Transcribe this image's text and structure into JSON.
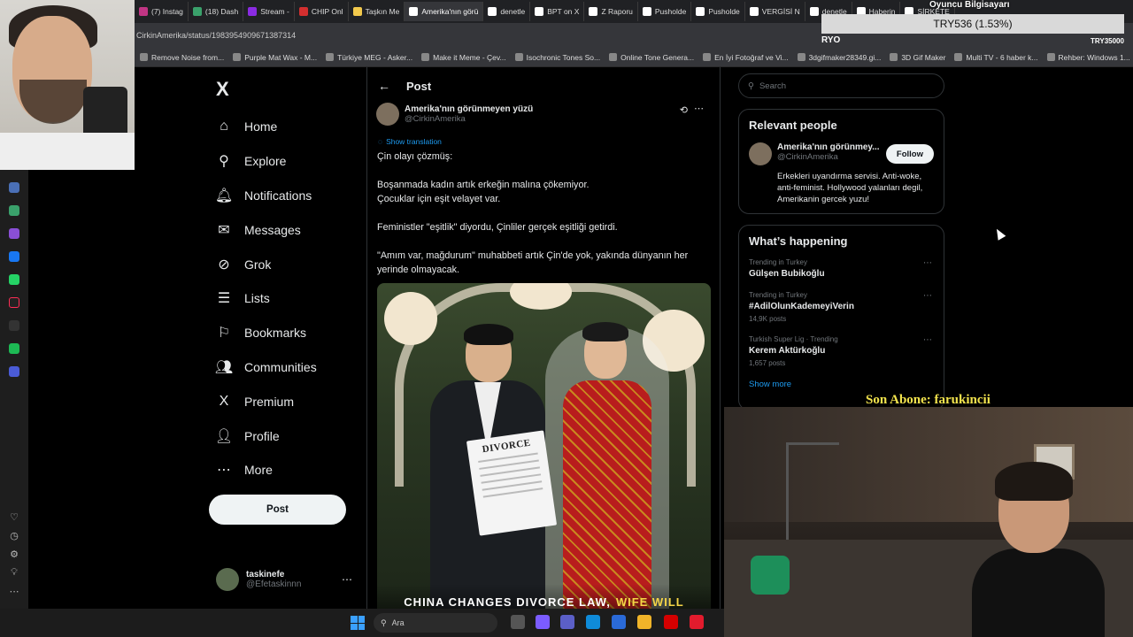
{
  "browser": {
    "tabs": [
      {
        "label": "(7) Instag",
        "color": "#c13584"
      },
      {
        "label": "(18) Dash",
        "color": "#3aa16b"
      },
      {
        "label": "Stream -",
        "color": "#8a2be2"
      },
      {
        "label": "CHIP Onl",
        "color": "#d32f2f"
      },
      {
        "label": "Taşkın Me",
        "color": "#f2c94c"
      },
      {
        "label": "Amerika'nın görü",
        "color": "#ffffff"
      },
      {
        "label": "denetle",
        "color": "#ffffff"
      },
      {
        "label": "BPT on X",
        "color": "#ffffff"
      },
      {
        "label": "Z Raporu",
        "color": "#ffffff"
      },
      {
        "label": "Pusholde",
        "color": "#ffffff"
      },
      {
        "label": "Pusholde",
        "color": "#ffffff"
      },
      {
        "label": "VERGİSİ N",
        "color": "#ffffff"
      },
      {
        "label": "denetle",
        "color": "#ffffff"
      },
      {
        "label": "Haberin",
        "color": "#ffffff"
      },
      {
        "label": "ŞİRKETE",
        "color": "#ffffff"
      }
    ],
    "active_tab": "Amerika'nın görü",
    "url": "CirkinAmerika/status/1983954909671387314",
    "bookmarks": [
      "Remove Noise from...",
      "Purple Mat Wax - M...",
      "Türkiye MEG - Asker...",
      "Make it Meme - Çev...",
      "Isochronic Tones So...",
      "Online Tone Genera...",
      "En İyi Fotoğraf ve Vi...",
      "3dgifmaker28349.gi...",
      "3D Gif Maker",
      "Multi TV - 6 haber k...",
      "Rehber: Windows 1..."
    ]
  },
  "sidebar": {
    "logo": "X",
    "items": [
      {
        "label": "Home",
        "icon": "home-icon",
        "glyph": "⌂"
      },
      {
        "label": "Explore",
        "icon": "search-icon",
        "glyph": "⚲"
      },
      {
        "label": "Notifications",
        "icon": "bell-icon",
        "glyph": "🔔︎"
      },
      {
        "label": "Messages",
        "icon": "envelope-icon",
        "glyph": "✉"
      },
      {
        "label": "Grok",
        "icon": "grok-icon",
        "glyph": "⊘"
      },
      {
        "label": "Lists",
        "icon": "list-icon",
        "glyph": "☰"
      },
      {
        "label": "Bookmarks",
        "icon": "bookmark-icon",
        "glyph": "⚐"
      },
      {
        "label": "Communities",
        "icon": "people-icon",
        "glyph": "👥︎"
      },
      {
        "label": "Premium",
        "icon": "x-icon",
        "glyph": "X"
      },
      {
        "label": "Profile",
        "icon": "person-icon",
        "glyph": "👤︎"
      },
      {
        "label": "More",
        "icon": "more-circle-icon",
        "glyph": "⋯"
      }
    ],
    "post_button": "Post",
    "account": {
      "name": "taskinefe",
      "handle": "@Efetaskinnn"
    }
  },
  "main": {
    "header_title": "Post",
    "author": {
      "name": "Amerika'nın görünmeyen yüzü",
      "handle": "@CirkinAmerika"
    },
    "show_translation": "Show translation",
    "tweet_paragraphs": [
      "Çin olayı çözmüş:",
      "Boşanmada kadın artık erkeğin malına çökemiyor.\nÇocuklar için eşit velayet var.",
      "Feministler \"eşitlik\" diyordu, Çinliler gerçek eşitliği getirdi.",
      "\"Amım var, mağdurum\" muhabbeti artık Çin'de yok, yakında dünyanın her yerinde olmayacak."
    ],
    "media": {
      "paper_text": "DIVORCE",
      "caption_main": "CHINA CHANGES DIVORCE LAW,",
      "caption_highlight": "WIFE WILL"
    }
  },
  "right": {
    "search_placeholder": "Search",
    "relevant": {
      "title": "Relevant people",
      "name": "Amerika'nın görünmey...",
      "handle": "@CirkinAmerika",
      "follow": "Follow",
      "bio": "Erkekleri uyandırma servisi. Anti-woke, anti-feminist. Hollywood yalanları degil, Amerikanin gercek yuzu!"
    },
    "happening": {
      "title": "What’s happening",
      "trends": [
        {
          "context": "Trending in Turkey",
          "title": "Gülşen Bubikoğlu",
          "count": ""
        },
        {
          "context": "Trending in Turkey",
          "title": "#AdilOlunKademeyiVerin",
          "count": "14,9K posts"
        },
        {
          "context": "Turkish Super Lig · Trending",
          "title": "Kerem Aktürkoğlu",
          "count": "1,657 posts"
        }
      ],
      "show_more": "Show more"
    }
  },
  "overlay": {
    "stock_ticker": "TRY536 (1.53%)",
    "game_label": "Oyuncu Bilgisayarı",
    "ryo": "RYO",
    "try35000": "TRY35000",
    "sub_banner": "Son Abone: farukincii"
  },
  "taskbar": {
    "search_label": "Ara"
  },
  "colors": {
    "accent": "#1d9bf0",
    "background": "#000000",
    "text": "#e7e9ea",
    "muted": "#71767b",
    "banner": "#f2e34d"
  }
}
